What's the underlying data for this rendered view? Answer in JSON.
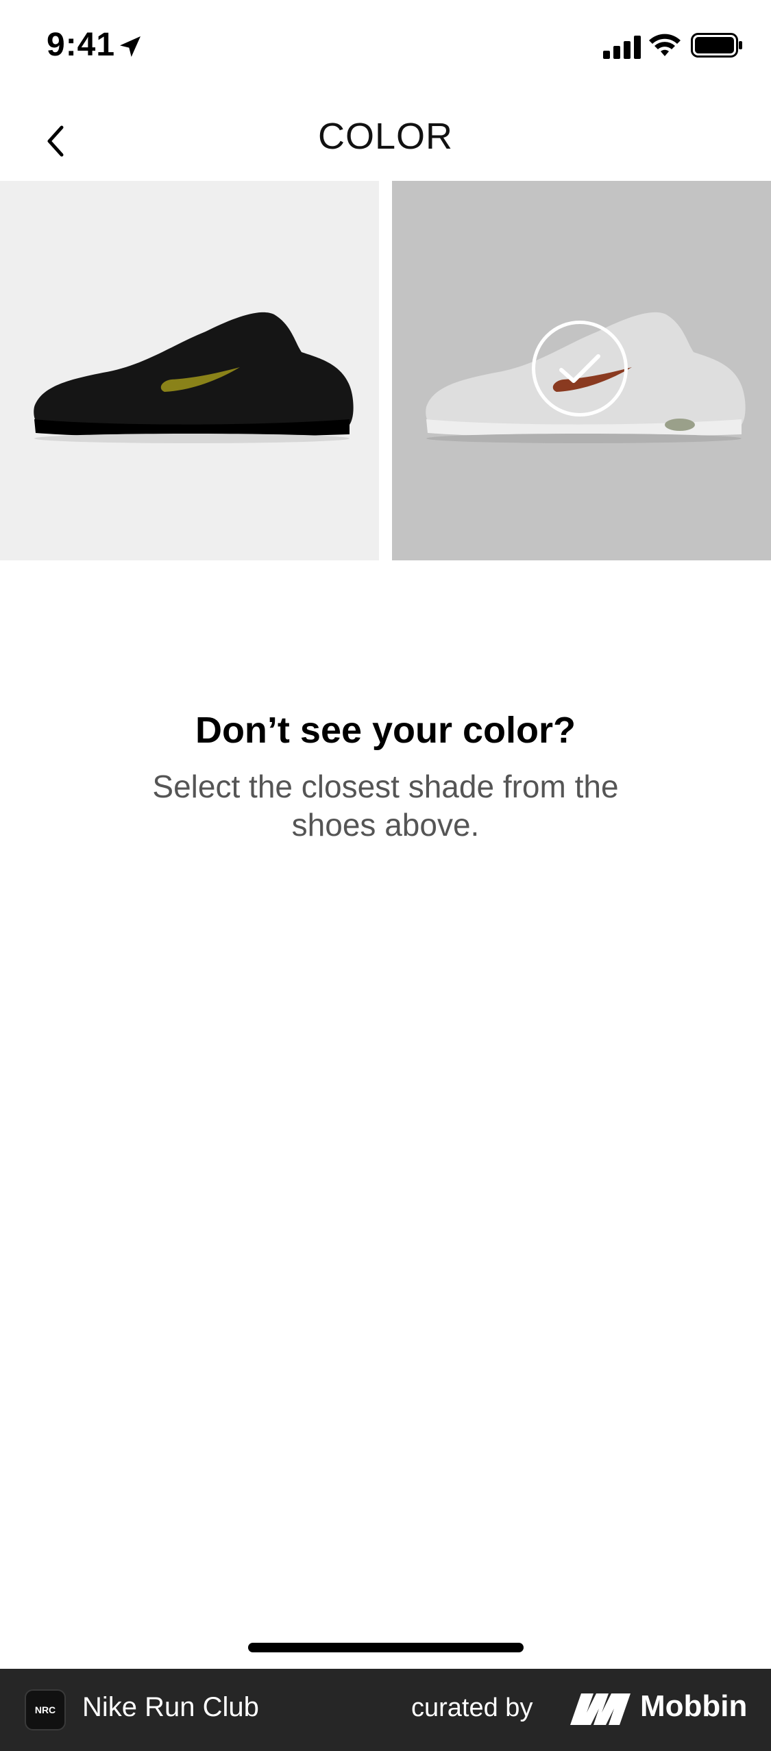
{
  "status_bar": {
    "time": "9:41",
    "icons": [
      "location-arrow-icon",
      "signal-icon",
      "wifi-icon",
      "battery-icon"
    ]
  },
  "header": {
    "title": "COLOR",
    "back_icon": "chevron-left-icon"
  },
  "swatches": [
    {
      "name": "black shoe",
      "background": "#efefef",
      "selected": false
    },
    {
      "name": "white shoe",
      "background": "#c3c3c3",
      "selected": true
    }
  ],
  "empty_state": {
    "title": "Don’t see your color?",
    "subtitle": "Select the closest shade from the shoes above."
  },
  "footer": {
    "app_icon_text": "NRC",
    "app_name": "Nike Run Club",
    "curated_by": "curated by",
    "brand": "Mobbin"
  }
}
